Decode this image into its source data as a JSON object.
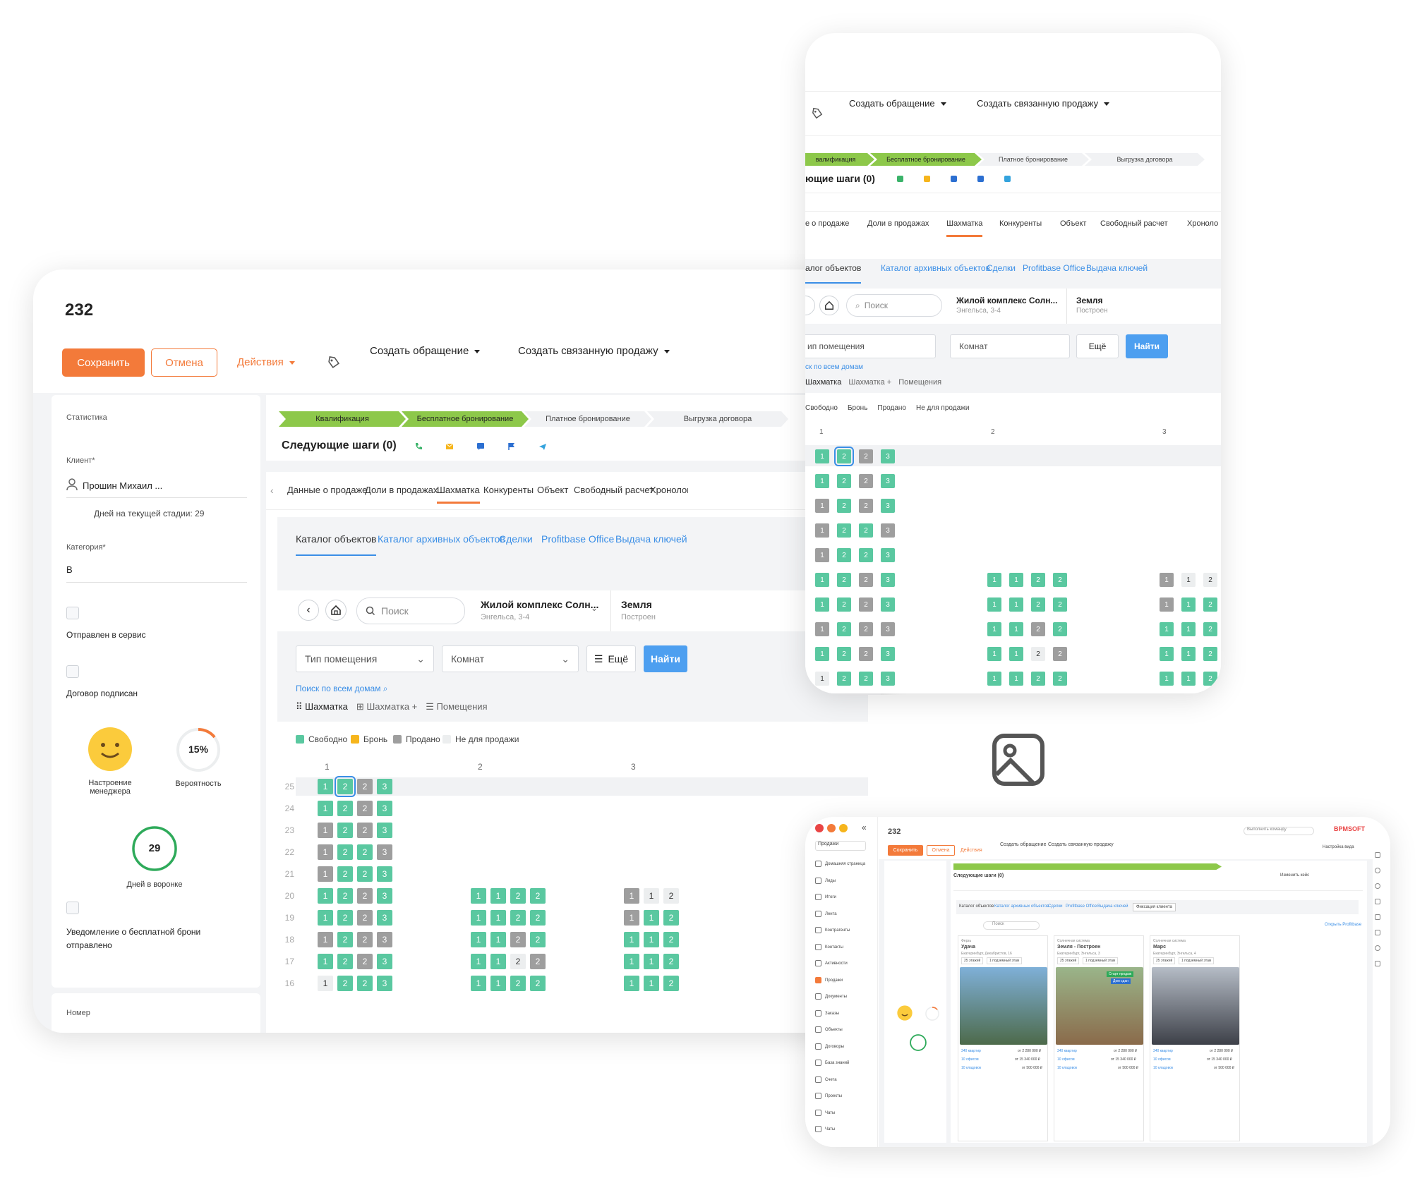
{
  "record": {
    "title": "232"
  },
  "toolbar": {
    "save": "Сохранить",
    "cancel": "Отмена",
    "actions": "Действия",
    "create_request": "Создать обращение",
    "create_sale": "Создать связанную продажу"
  },
  "left_panel": {
    "stats": "Статистика",
    "client_label": "Клиент*",
    "client_value": "Прошин Михаил ...",
    "days_stage": "Дней на текущей стадии: 29",
    "category_label": "Категория*",
    "category_value": "В",
    "sent_service": "Отправлен в сервис",
    "contract_signed": "Договор подписан",
    "mood_label": "Настроение менеджера",
    "probability_value": "15%",
    "probability_label": "Вероятность",
    "funnel_days_value": "29",
    "funnel_days_label": "Дней в воронке",
    "notify": "Уведомление о бесплатной брони отправлено",
    "number_label": "Номер"
  },
  "stages": [
    "Квалификация",
    "Бесплатное бронирование",
    "Платное бронирование",
    "Выгрузка договора"
  ],
  "next_steps": "Следующие шаги (0)",
  "tabs": [
    "Данные о продаже",
    "Доли в продажах",
    "Шахматка",
    "Конкуренты",
    "Объект",
    "Свободный расчет",
    "Хронология"
  ],
  "subtabs": [
    "Каталог объектов",
    "Каталог архивных объектов",
    "Сделки",
    "Profitbase Office",
    "Выдача ключей"
  ],
  "filters": {
    "search_placeholder": "Поиск",
    "complex_name": "Жилой комплекс Солн...",
    "complex_addr": "Энгельса, 3-4",
    "house_name": "Земля",
    "house_status": "Построен",
    "room_type": "Тип помещения",
    "rooms": "Комнат",
    "more": "Ещё",
    "find": "Найти",
    "search_all": "Поиск по всем домам"
  },
  "views": [
    "Шахматка",
    "Шахматка +",
    "Помещения"
  ],
  "legend": [
    {
      "label": "Свободно",
      "color": "#5ac8a0"
    },
    {
      "label": "Бронь",
      "color": "#f6b51c"
    },
    {
      "label": "Продано",
      "color": "#9e9e9e"
    },
    {
      "label": "Не для продажи",
      "color": "#eceeef"
    }
  ],
  "sections": [
    "1",
    "2",
    "3"
  ],
  "floors": [
    "25",
    "24",
    "23",
    "22",
    "21",
    "20",
    "19",
    "18",
    "17",
    "16"
  ],
  "grid": {
    "s1": [
      [
        "g",
        "sel",
        "s",
        "g"
      ],
      [
        "g",
        "g",
        "s",
        "g"
      ],
      [
        "s",
        "g",
        "s",
        "g"
      ],
      [
        "s",
        "g",
        "g",
        "s"
      ],
      [
        "s",
        "g",
        "g",
        "g"
      ],
      [
        "g",
        "g",
        "s",
        "g"
      ],
      [
        "g",
        "g",
        "s",
        "g"
      ],
      [
        "s",
        "g",
        "s",
        "s"
      ],
      [
        "g",
        "g",
        "s",
        "g"
      ],
      [
        "n",
        "g",
        "g",
        "g"
      ]
    ],
    "s1_labels": [
      [
        "1",
        "2",
        "2",
        "3"
      ],
      [
        "1",
        "2",
        "2",
        "3"
      ],
      [
        "1",
        "2",
        "2",
        "3"
      ],
      [
        "1",
        "2",
        "2",
        "3"
      ],
      [
        "1",
        "2",
        "2",
        "3"
      ],
      [
        "1",
        "2",
        "2",
        "3"
      ],
      [
        "1",
        "2",
        "2",
        "3"
      ],
      [
        "1",
        "2",
        "2",
        "3"
      ],
      [
        "1",
        "2",
        "2",
        "3"
      ],
      [
        "1",
        "2",
        "2",
        "3"
      ]
    ],
    "s2": [
      null,
      null,
      null,
      null,
      null,
      [
        "g",
        "g",
        "g",
        "g"
      ],
      [
        "g",
        "g",
        "g",
        "g"
      ],
      [
        "g",
        "g",
        "s",
        "g"
      ],
      [
        "g",
        "g",
        "n",
        "s"
      ],
      [
        "g",
        "g",
        "g",
        "g"
      ]
    ],
    "s2_labels": [
      null,
      null,
      null,
      null,
      null,
      [
        "1",
        "1",
        "2",
        "2"
      ],
      [
        "1",
        "1",
        "2",
        "2"
      ],
      [
        "1",
        "1",
        "2",
        "2"
      ],
      [
        "1",
        "1",
        "2",
        "2"
      ],
      [
        "1",
        "1",
        "2",
        "2"
      ]
    ],
    "s3": [
      null,
      null,
      null,
      null,
      null,
      [
        "s",
        "n",
        "n"
      ],
      [
        "s",
        "g",
        "g"
      ],
      [
        "g",
        "g",
        "g"
      ],
      [
        "g",
        "g",
        "g"
      ],
      [
        "g",
        "g",
        "g"
      ]
    ],
    "s3_labels": [
      null,
      null,
      null,
      null,
      null,
      [
        "1",
        "1",
        "2"
      ],
      [
        "1",
        "1",
        "2"
      ],
      [
        "1",
        "1",
        "2"
      ],
      [
        "1",
        "1",
        "2"
      ],
      [
        "1",
        "1",
        "2"
      ]
    ]
  },
  "tr": {
    "stages": [
      "валификация",
      "Бесплатное бронирование",
      "Платное бронирование",
      "Выгрузка договора"
    ],
    "next_steps": "ющие шаги (0)",
    "tabs": [
      "е о продаже",
      "Доли в продажах",
      "Шахматка",
      "Конкуренты",
      "Объект",
      "Свободный расчет",
      "Хроноло"
    ],
    "subtabs": [
      "алог объектов",
      "Каталог архивных объектов",
      "Сделки",
      "Profitbase Office",
      "Выдача ключей"
    ],
    "room_type": "ип помещения",
    "search_all": "ск по всем домам",
    "views": [
      "Шахматка",
      "Шахматка +",
      "Помещения"
    ],
    "legend": [
      "Свободно",
      "Бронь",
      "Продано",
      "Не для продажи"
    ]
  },
  "br": {
    "title": "232",
    "save": "Сохранить",
    "cancel": "Отмена",
    "actions": "Действия",
    "create_request": "Создать обращение",
    "create_sale": "Создать связанную продажу",
    "command": "Выполнить команду",
    "brand": "BPMSOFT",
    "view_settings": "Настройка вида",
    "change_case": "Изменить кейс",
    "sidebar": [
      "Домашняя страница",
      "Лиды",
      "Итоги",
      "Лента",
      "Контрагенты",
      "Контакты",
      "Активности",
      "Продажи",
      "Документы",
      "Заказы",
      "Объекты",
      "Договоры",
      "База знаний",
      "Счета",
      "Проекты",
      "Чаты",
      "Чаты"
    ],
    "sidebar_header": "Продажи",
    "open_profitbase": "Открыть Profitbase",
    "catalog_tabs": [
      "Каталог объектов",
      "Каталог архивных объектов",
      "Сделки",
      "Profitbase Office",
      "Выдача ключей",
      "Фиксация клиента"
    ],
    "objects": [
      {
        "region": "Ферзь",
        "name": "Удача",
        "address": "Екатеринбург, Декабристов, 16",
        "floors": "25 этажей",
        "underground": "1 подземный этаж",
        "flats": "340 квартир",
        "flats_price": "от 2 280 000 ₽",
        "offices": "10 офисов",
        "offices_price": "от 15 340 000 ₽",
        "storages": "10 кладовок",
        "storages_price": "от 500 000 ₽"
      },
      {
        "region": "Солнечная система",
        "name": "Земля - Построен",
        "address": "Екатеринбург, Энгельса, 3",
        "floors": "25 этажей",
        "underground": "1 подземный этаж",
        "flats": "340 квартир",
        "flats_price": "от 2 280 000 ₽",
        "offices": "10 офисов",
        "offices_price": "от 15 340 000 ₽",
        "storages": "10 кладовок",
        "storages_price": "от 500 000 ₽",
        "badge1": "Старт продаж",
        "badge2": "Дом сдан"
      },
      {
        "region": "Солнечная система",
        "name": "Марс",
        "address": "Екатеринбург, Энгельса, 4",
        "floors": "25 этажей",
        "underground": "1 подземный этаж",
        "flats": "340 квартир",
        "flats_price": "от 2 280 000 ₽",
        "offices": "10 офисов",
        "offices_price": "от 15 340 000 ₽",
        "storages": "10 кладовок",
        "storages_price": "от 500 000 ₽"
      }
    ]
  },
  "colors": {
    "accent": "#f37a3a",
    "link": "#3a8ee6",
    "free": "#5ac8a0",
    "sold": "#9e9e9e",
    "stage_on": "#8dc84a"
  }
}
